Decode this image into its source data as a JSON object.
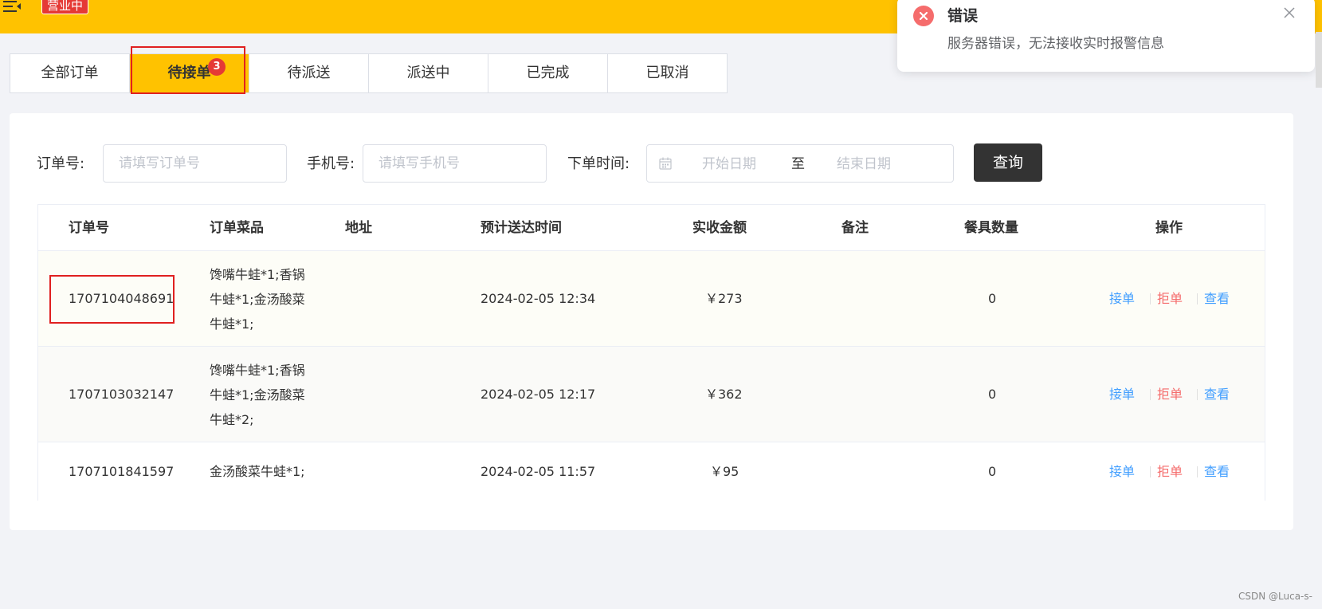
{
  "header": {
    "status_badge": "营业中",
    "bg_color": "#ffc200"
  },
  "tabs": [
    {
      "label": "全部订单"
    },
    {
      "label": "待接单",
      "count": "3",
      "active": true
    },
    {
      "label": "待派送"
    },
    {
      "label": "派送中"
    },
    {
      "label": "已完成"
    },
    {
      "label": "已取消"
    }
  ],
  "filters": {
    "order_no_label": "订单号:",
    "order_no_placeholder": "请填写订单号",
    "phone_label": "手机号:",
    "phone_placeholder": "请填写手机号",
    "time_label": "下单时间:",
    "date_start_placeholder": "开始日期",
    "date_separator": "至",
    "date_end_placeholder": "结束日期",
    "query_button": "查询"
  },
  "table": {
    "columns": [
      "订单号",
      "订单菜品",
      "地址",
      "预计送达时间",
      "实收金额",
      "备注",
      "餐具数量",
      "操作"
    ],
    "rows": [
      {
        "order_no": "1707104048691",
        "dishes": [
          "馋嘴牛蛙*1;香锅",
          "牛蛙*1;金汤酸菜",
          "牛蛙*1;"
        ],
        "address": "",
        "eta": "2024-02-05 12:34",
        "amount": "￥273",
        "remark": "",
        "tableware": "0"
      },
      {
        "order_no": "1707103032147",
        "dishes": [
          "馋嘴牛蛙*1;香锅",
          "牛蛙*1;金汤酸菜",
          "牛蛙*2;"
        ],
        "address": "",
        "eta": "2024-02-05 12:17",
        "amount": "￥362",
        "remark": "",
        "tableware": "0"
      },
      {
        "order_no": "1707101841597",
        "dishes": [
          "金汤酸菜牛蛙*1;"
        ],
        "address": "",
        "eta": "2024-02-05 11:57",
        "amount": "￥95",
        "remark": "",
        "tableware": "0"
      }
    ],
    "actions": {
      "accept": "接单",
      "reject": "拒单",
      "view": "查看"
    }
  },
  "notification": {
    "title": "错误",
    "message": "服务器错误，无法接收实时报警信息"
  },
  "watermark": "CSDN @Luca-s-",
  "colors": {
    "accent": "#ffc200",
    "danger": "#e53935",
    "link": "#419eff",
    "reject": "#f56c6c"
  }
}
